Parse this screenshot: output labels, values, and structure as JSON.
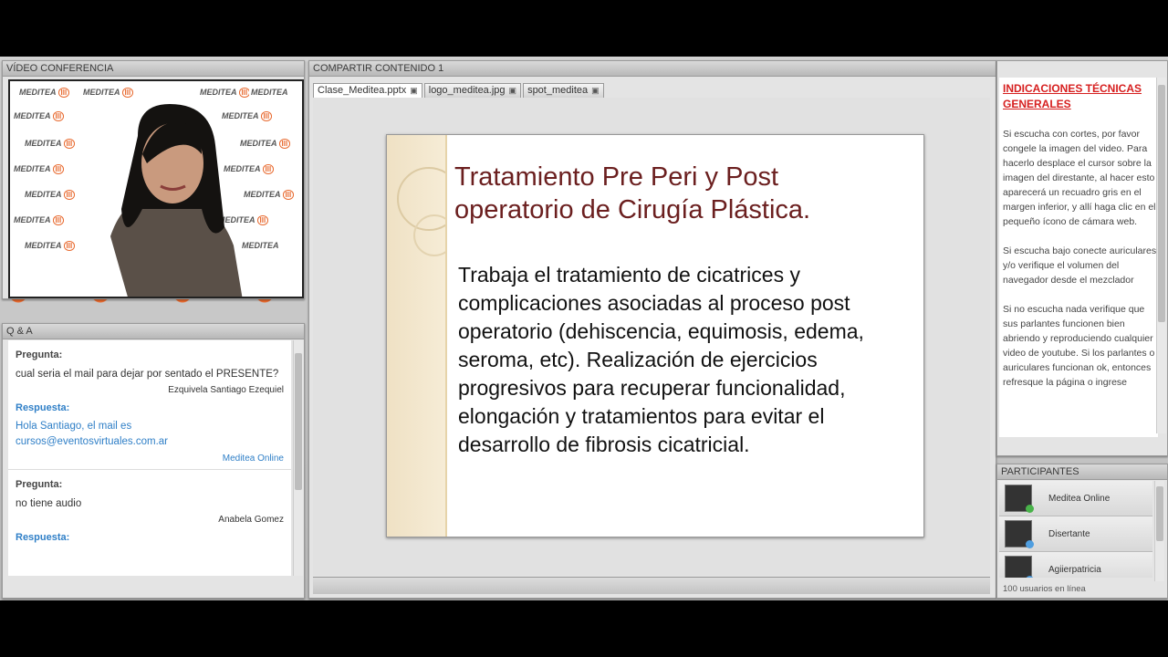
{
  "video": {
    "title": "VÍDEO CONFERENCIA",
    "logo_text": "MEDITEA"
  },
  "qa": {
    "title": "Q & A",
    "items": [
      {
        "q_label": "Pregunta:",
        "question": "cual seria el mail para dejar por sentado el PRESENTE?",
        "asker": "Ezquivela Santiago Ezequiel",
        "a_label": "Respuesta:",
        "answer": "Hola Santiago, el mail es cursos@eventosvirtuales.com.ar",
        "answerer": "Meditea Online"
      },
      {
        "q_label": "Pregunta:",
        "question": "no tiene audio",
        "asker": "Anabela Gomez",
        "a_label": "Respuesta:"
      }
    ]
  },
  "share": {
    "title": "COMPARTIR CONTENIDO 1",
    "tabs": [
      "Clase_Meditea.pptx",
      "logo_meditea.jpg",
      "spot_meditea"
    ],
    "slide": {
      "title": "Tratamiento Pre Peri y Post operatorio de Cirugía Plástica.",
      "body": "Trabaja  el tratamiento de cicatrices y complicaciones asociadas al proceso post operatorio (dehiscencia, equimosis, edema, seroma, etc). Realización de ejercicios progresivos para recuperar funcionalidad, elongación y tratamientos para evitar el desarrollo de fibrosis cicatricial."
    }
  },
  "info": {
    "heading": "INDICACIONES TÉCNICAS GENERALES",
    "paragraphs": [
      "Si escucha con cortes, por favor congele la imagen del video. Para hacerlo desplace el cursor sobre la imagen del direstante, al hacer esto aparecerá un recuadro gris en el margen inferior, y allí haga clic en el pequeño ícono de cámara web.",
      "Si escucha bajo conecte auriculares y/o verifique el volumen del navegador desde el mezclador",
      "Si no escucha nada verifique que sus parlantes funcionen bien abriendo y reproduciendo cualquier video de youtube. Si los parlantes o auriculares funcionan ok, entonces refresque la página o ingrese"
    ]
  },
  "participants": {
    "title": "PARTICIPANTES",
    "list": [
      "Meditea Online",
      "Disertante",
      "Agiierpatricia"
    ],
    "count_text": "100 usuarios en línea"
  }
}
